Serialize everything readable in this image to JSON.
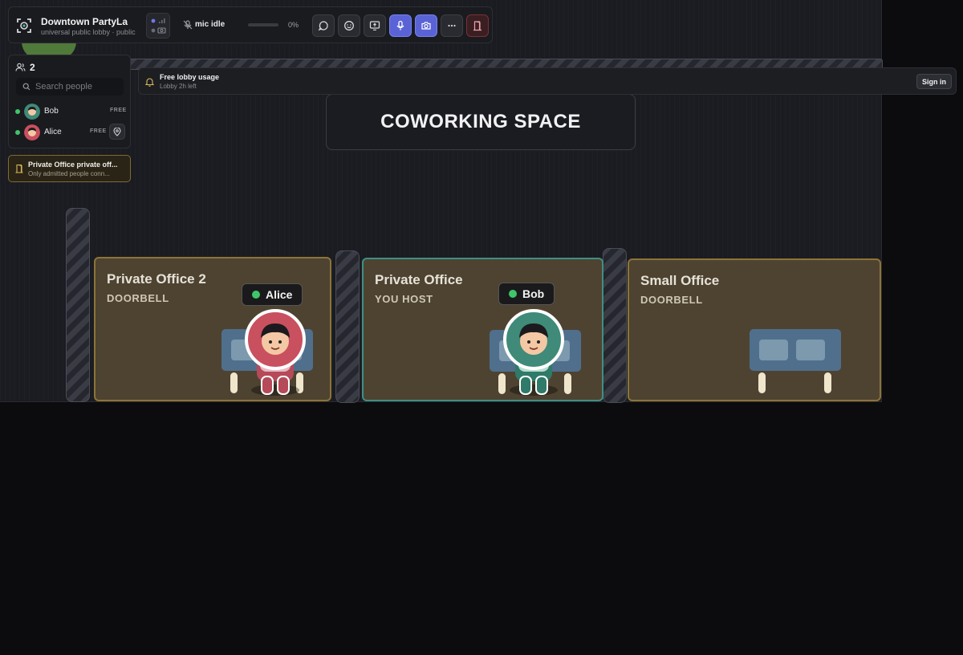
{
  "topbar": {
    "lobby_name": "Downtown PartyLa",
    "lobby_subtitle": "universal public lobby · public",
    "mic_label": "mic idle",
    "mic_level": 0,
    "mic_percent": "0%",
    "buttons": [
      "chat-icon",
      "emoji-icon",
      "screen-share-icon",
      "microphone-icon",
      "camera-icon",
      "more-icon",
      "leave-icon"
    ]
  },
  "people": {
    "count": "2",
    "search_placeholder": "Search people",
    "list": [
      {
        "name": "Bob",
        "badge": "FREE"
      },
      {
        "name": "Alice",
        "badge": "FREE"
      }
    ]
  },
  "office_notice": {
    "title": "Private Office private off...",
    "subtitle": "Only admitted people conn..."
  },
  "banner": {
    "title": "Free lobby usage",
    "subtitle": "Lobby 2h left",
    "signin_label": "Sign in"
  },
  "map": {
    "sign": "COWORKING SPACE",
    "offices": [
      {
        "title": "Private Office 2",
        "subtitle": "DOORBELL"
      },
      {
        "title": "Private Office",
        "subtitle": "YOU HOST"
      },
      {
        "title": "Small Office",
        "subtitle": "DOORBELL"
      }
    ],
    "avatars": [
      {
        "name": "Alice",
        "color": "#c9505f"
      },
      {
        "name": "Bob",
        "color": "#3f8a78"
      }
    ]
  }
}
